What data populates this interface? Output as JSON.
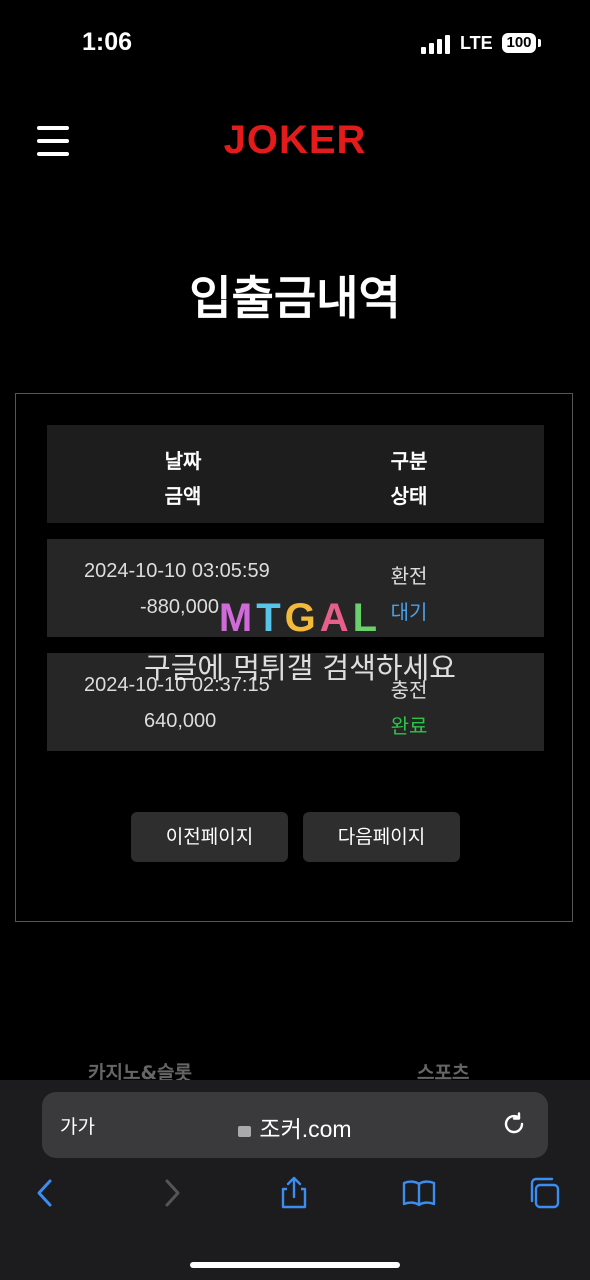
{
  "status": {
    "time": "1:06",
    "network": "LTE",
    "battery": "100"
  },
  "header": {
    "logo": "JOKER"
  },
  "page": {
    "title": "입출금내역"
  },
  "table": {
    "headers": {
      "col1_line1": "날짜",
      "col1_line2": "금액",
      "col2_line1": "구분",
      "col2_line2": "상태"
    },
    "rows": [
      {
        "date": "2024-10-10 03:05:59",
        "amount": "-880,000",
        "type": "환전",
        "status": "대기"
      },
      {
        "date": "2024-10-10 02:37:15",
        "amount": "640,000",
        "type": "충전",
        "status": "완료"
      }
    ]
  },
  "pagination": {
    "prev": "이전페이지",
    "next": "다음페이지"
  },
  "watermark": {
    "logo": "MTGAL",
    "text": "구글에 먹튀갤 검색하세요"
  },
  "footer_nav": {
    "item1": "카지노&슬롯",
    "item2": "스포츠"
  },
  "browser": {
    "text_size": "가가",
    "url": "조커.com"
  },
  "colors": {
    "logo": "#e31b1b",
    "status_wait": "#4b9fe6",
    "status_done": "#2fc24a"
  }
}
